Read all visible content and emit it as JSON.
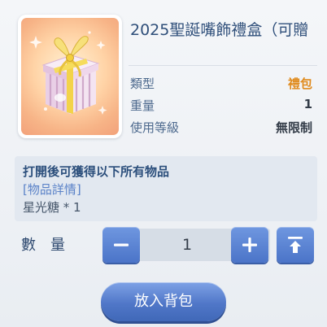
{
  "item": {
    "title": "2025聖誕嘴飾禮盒（可贈",
    "rows": [
      {
        "label": "類型",
        "value": "禮包"
      },
      {
        "label": "重量",
        "value": "1"
      },
      {
        "label": "使用等級",
        "value": "無限制"
      }
    ]
  },
  "description": {
    "line1": "打開後可獲得以下所有物品",
    "details_link": "[物品詳情]",
    "contents": "星光糖 * 1"
  },
  "quantity": {
    "label": "數量",
    "value": "1"
  },
  "actions": {
    "put_in_bag": "放入背包"
  },
  "colors": {
    "accent_blue": "#5077c8",
    "type_value": "#e08a1c",
    "label_blue": "#4e6a8e"
  }
}
